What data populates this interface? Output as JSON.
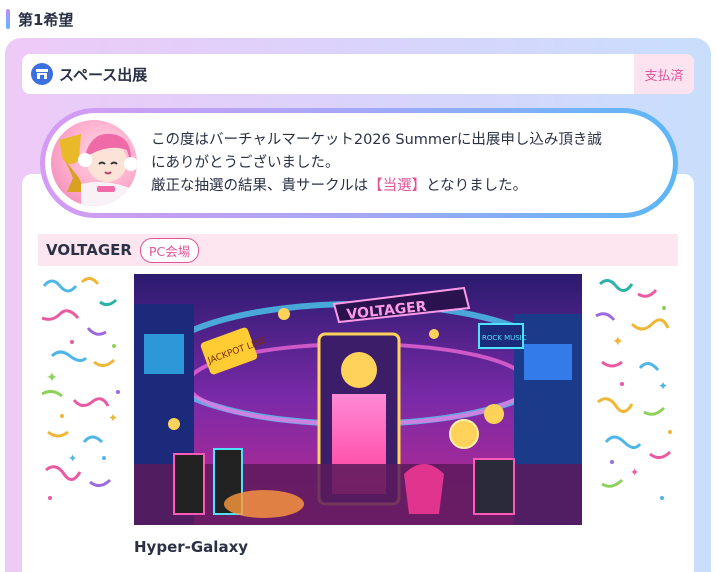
{
  "section": {
    "title": "第1希望"
  },
  "space": {
    "label": "スペース出展",
    "status": "支払済",
    "icon": "store-icon"
  },
  "message": {
    "line1": "この度はバーチャルマーケット2026 Summerに出展申し込み頂き誠",
    "line2": "にありがとうございました。",
    "line3_pre": "厳正な抽選の結果、貴サークルは",
    "result": "【当選】",
    "line3_post": "となりました。"
  },
  "circle": {
    "name": "VOLTAGER",
    "venue": "PC会場"
  },
  "banner": {
    "sign": "VOLTAGER",
    "sub_sign": "JACKPOT LINE",
    "side_sign": "ROCK MUSIC"
  },
  "work": {
    "title": "Hyper-Galaxy"
  },
  "colors": {
    "accent_pink": "#e0559a",
    "accent_blue": "#3d6fe0",
    "paid_bg": "#fde3ef"
  }
}
